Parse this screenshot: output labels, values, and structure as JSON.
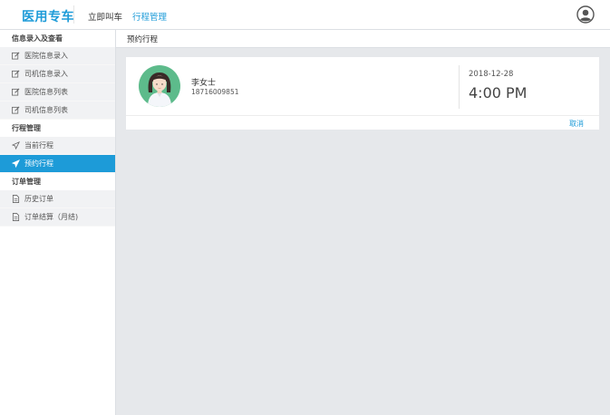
{
  "header": {
    "brand": "医用专车",
    "nav": [
      {
        "label": "立即叫车",
        "active": false
      },
      {
        "label": "行程管理",
        "active": true
      }
    ],
    "user_icon": "user-circle-icon"
  },
  "sidebar": {
    "sections": [
      {
        "title": "信息录入及查看",
        "items": [
          {
            "label": "医院信息录入",
            "icon": "edit-icon"
          },
          {
            "label": "司机信息录入",
            "icon": "edit-icon"
          },
          {
            "label": "医院信息列表",
            "icon": "edit-icon"
          },
          {
            "label": "司机信息列表",
            "icon": "edit-icon"
          }
        ]
      },
      {
        "title": "行程管理",
        "items": [
          {
            "label": "当前行程",
            "icon": "send-icon"
          },
          {
            "label": "预约行程",
            "icon": "send-icon",
            "active": true
          }
        ]
      },
      {
        "title": "订单管理",
        "items": [
          {
            "label": "历史订单",
            "icon": "document-icon"
          },
          {
            "label": "订单结算（月结)",
            "icon": "document-icon"
          }
        ]
      }
    ]
  },
  "main": {
    "title": "预约行程",
    "trip": {
      "passenger_name": "李女士",
      "passenger_phone": "18716009851",
      "date": "2018-12-28",
      "time": "4:00 PM",
      "cancel_label": "取消"
    }
  },
  "colors": {
    "accent": "#1d9bd8",
    "background": "#e6e8eb",
    "sidebar_item_bg": "#f1f2f4"
  }
}
